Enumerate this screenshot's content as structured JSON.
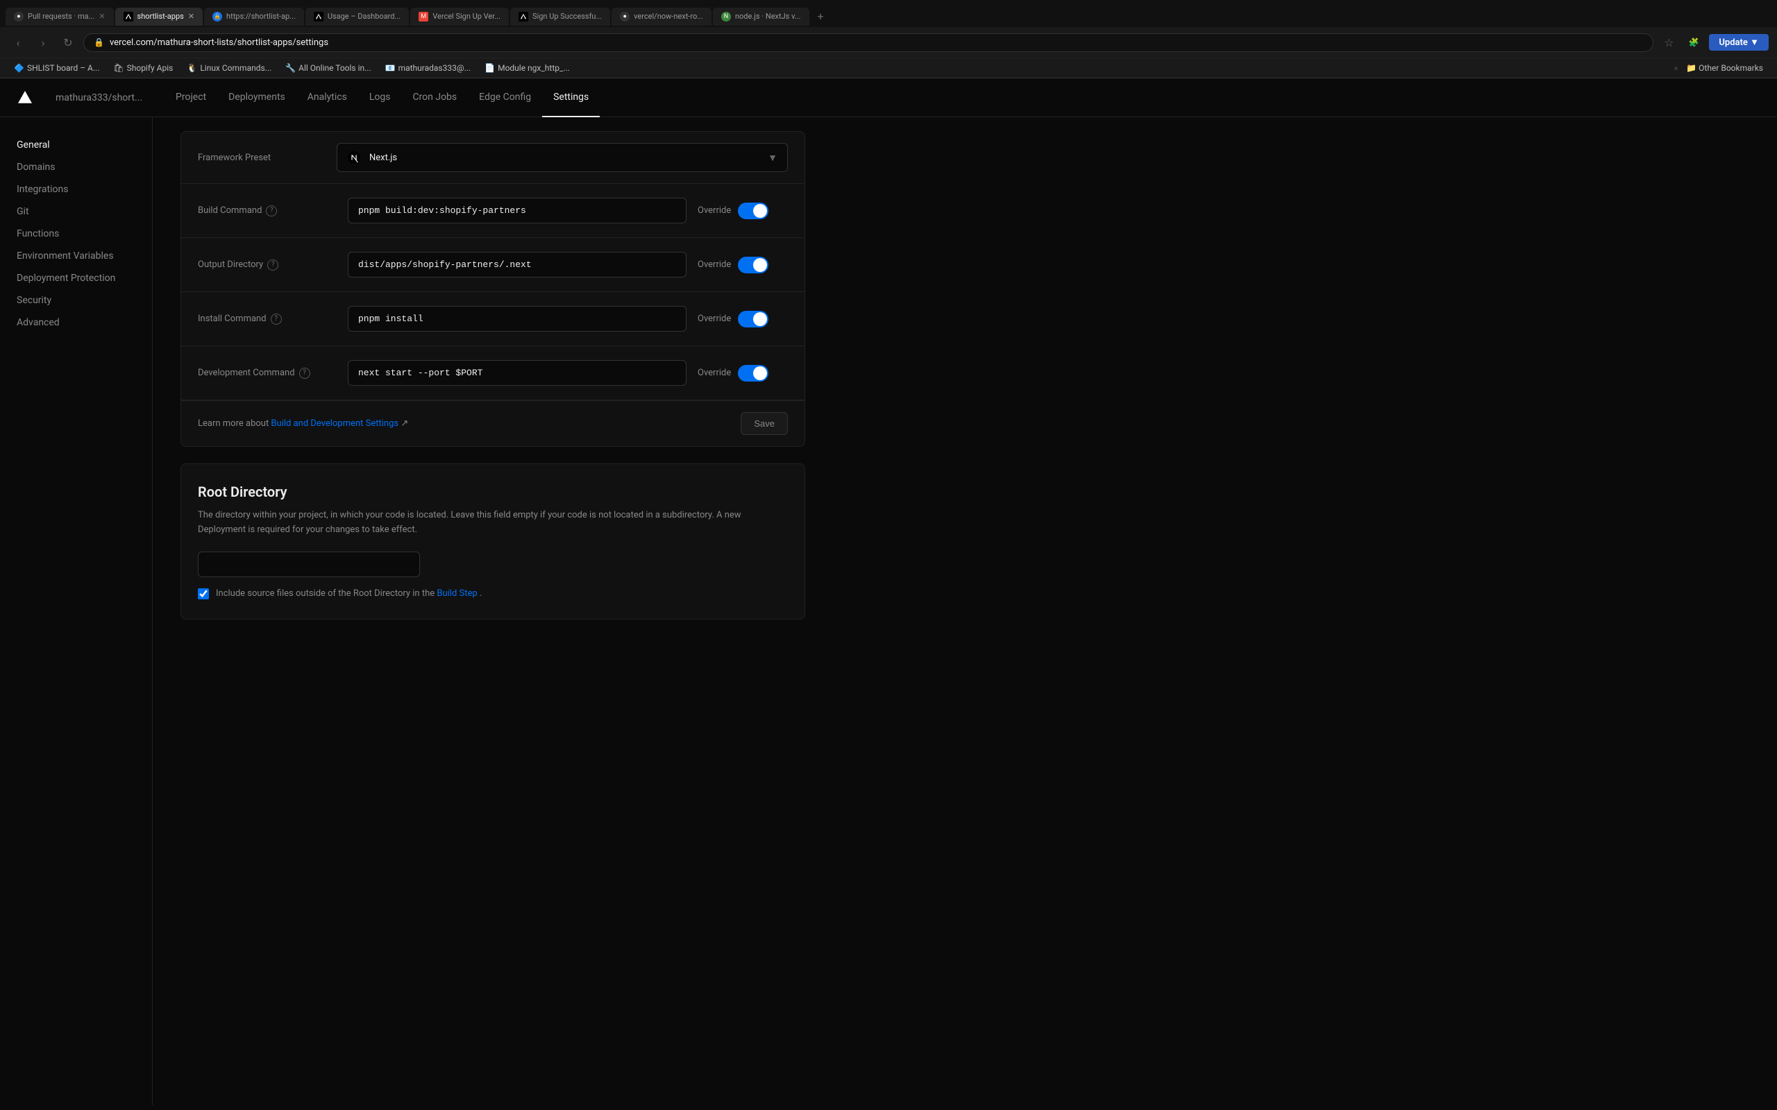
{
  "browser": {
    "tabs": [
      {
        "id": "tab-1",
        "favicon": "gh",
        "label": "Pull requests · ma...",
        "active": false,
        "closeable": true
      },
      {
        "id": "tab-2",
        "favicon": "vercel",
        "label": "shortlist-apps",
        "active": true,
        "closeable": true
      },
      {
        "id": "tab-3",
        "favicon": "globe",
        "label": "https://shortlist-ap...",
        "active": false,
        "closeable": false
      },
      {
        "id": "tab-4",
        "favicon": "vercel",
        "label": "Usage – Dashboard...",
        "active": false,
        "closeable": false
      },
      {
        "id": "tab-5",
        "favicon": "gmail",
        "label": "Vercel Sign Up Ver...",
        "active": false,
        "closeable": false
      },
      {
        "id": "tab-6",
        "favicon": "vercel",
        "label": "Sign Up Successfu...",
        "active": false,
        "closeable": false
      },
      {
        "id": "tab-7",
        "favicon": "gh",
        "label": "vercel/now-next-ro...",
        "active": false,
        "closeable": false
      },
      {
        "id": "tab-8",
        "favicon": "node",
        "label": "node.js · NextJs v...",
        "active": false,
        "closeable": false
      }
    ],
    "address": "vercel.com/mathura-short-lists/shortlist-apps/settings",
    "bookmarks": [
      "SHLIST board – A...",
      "Shopify Apis",
      "Linux Commands...",
      "All Online Tools in...",
      "mathuradas333@...",
      "Module ngx_http_..."
    ]
  },
  "app": {
    "project": "mathura333/short...",
    "nav": [
      {
        "id": "project",
        "label": "Project"
      },
      {
        "id": "deployments",
        "label": "Deployments"
      },
      {
        "id": "analytics",
        "label": "Analytics"
      },
      {
        "id": "logs",
        "label": "Logs"
      },
      {
        "id": "cron-jobs",
        "label": "Cron Jobs"
      },
      {
        "id": "edge-config",
        "label": "Edge Config"
      },
      {
        "id": "settings",
        "label": "Settings",
        "active": true
      }
    ]
  },
  "sidebar": {
    "items": [
      {
        "id": "general",
        "label": "General",
        "active": true
      },
      {
        "id": "domains",
        "label": "Domains"
      },
      {
        "id": "integrations",
        "label": "Integrations"
      },
      {
        "id": "git",
        "label": "Git"
      },
      {
        "id": "functions",
        "label": "Functions"
      },
      {
        "id": "environment-variables",
        "label": "Environment Variables"
      },
      {
        "id": "deployment-protection",
        "label": "Deployment Protection"
      },
      {
        "id": "security",
        "label": "Security"
      },
      {
        "id": "advanced",
        "label": "Advanced"
      }
    ]
  },
  "build_settings": {
    "framework": {
      "icon": "⊙",
      "name": "Next.js"
    },
    "build_command": {
      "label": "Build Command",
      "value": "pnpm build:dev:shopify-partners",
      "override": true
    },
    "output_directory": {
      "label": "Output Directory",
      "value": "dist/apps/shopify-partners/.next",
      "override": true
    },
    "install_command": {
      "label": "Install Command",
      "value": "pnpm install",
      "override": true
    },
    "development_command": {
      "label": "Development Command",
      "value": "next start --port $PORT",
      "override": true
    },
    "learn_more_text": "Learn more about ",
    "learn_more_link": "Build and Development Settings",
    "save_label": "Save",
    "override_label": "Override"
  },
  "root_directory": {
    "title": "Root Directory",
    "description": "The directory within your project, in which your code is located. Leave this field empty if your code is not located in a subdirectory. A new Deployment is required for your changes to take effect.",
    "input_placeholder": "",
    "checkbox_checked": true,
    "checkbox_label": "Include source files outside of the Root Directory in the ",
    "checkbox_link": "Build Step",
    "period": "."
  }
}
